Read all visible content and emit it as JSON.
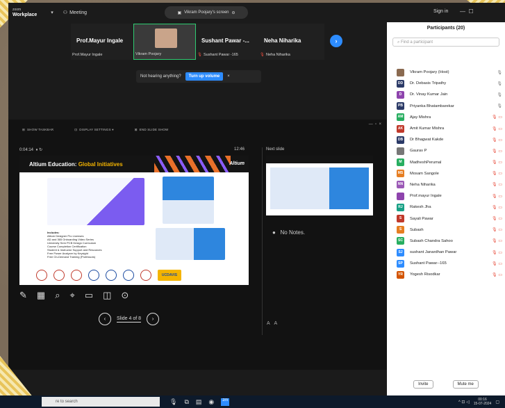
{
  "app": {
    "brand_top": "zoom",
    "brand": "Workplace",
    "meeting_label": "Meeting",
    "share_pill": "Vikram Poojary's screen",
    "signin": "Sign in"
  },
  "strip": [
    {
      "name": "Prof.Mayur Ingale",
      "sub": "Prof.Mayur Ingale",
      "muted": false,
      "active": false
    },
    {
      "name": "",
      "sub": "Vikram Poojary",
      "muted": false,
      "active": true
    },
    {
      "name": "Sushant Pawar -...",
      "sub": "Sushant Pawar -165",
      "muted": true,
      "active": false
    },
    {
      "name": "Neha Niharika",
      "sub": "Neha Niharika",
      "muted": true,
      "active": false
    }
  ],
  "notice": {
    "text": "Not hearing anything?",
    "button": "Turn up volume"
  },
  "presenter": {
    "toolbar": [
      "SHOW TASKBAR",
      "DISPLAY SETTINGS ▾",
      "END SLIDE SHOW"
    ],
    "timer": "0:04:14",
    "clock": "12:46",
    "next_slide_label": "Next slide",
    "notes": "No Notes.",
    "slide_nav": "Slide 4 of 8",
    "slide": {
      "title_part1": "Altium Education:",
      "title_part2": "Global Initiatives",
      "brand": "Altium",
      "includes": [
        "Includes:",
        "Altium Designer Pro Licenses",
        "AD and 365 Onboarding Video Series",
        "University Sem PCB Design Curriculum",
        "Course Completion Certification",
        "Student & Instructor Support and Resources",
        "Free Power Analyzer by Keysight",
        "Free On-Demand Training (Professors)"
      ],
      "ucdavis": "UCDAVIS"
    }
  },
  "participants": {
    "title": "Participants (20)",
    "search_placeholder": "Find a participant",
    "list": [
      {
        "initials": "",
        "name": "Vikram Poojary (Host)",
        "color": "#8a6a50",
        "muted": false
      },
      {
        "initials": "DD",
        "name": "Dr. Debasis Tripathy",
        "color": "#2b3a67",
        "muted": false
      },
      {
        "initials": "D",
        "name": "Dr. Vinay Kumar Jain",
        "color": "#8e44ad",
        "muted": false
      },
      {
        "initials": "PB",
        "name": "Priyanka Bhatambarekar",
        "color": "#2b3a67",
        "muted": false
      },
      {
        "initials": "AM",
        "name": "Ajay Mishra",
        "color": "#27ae60",
        "muted": true
      },
      {
        "initials": "AK",
        "name": "Amit Kumar Mishra",
        "color": "#c0392b",
        "muted": true
      },
      {
        "initials": "DB",
        "name": "Dr Bhagwat Kakde",
        "color": "#2b3a67",
        "muted": true
      },
      {
        "initials": "",
        "name": "Gaurav P",
        "color": "#777777",
        "muted": true
      },
      {
        "initials": "M",
        "name": "MadheshPerumal",
        "color": "#27ae60",
        "muted": true
      },
      {
        "initials": "MS",
        "name": "Mosam Sangole",
        "color": "#e67e22",
        "muted": true
      },
      {
        "initials": "NN",
        "name": "Neha Niharika",
        "color": "#9b59b6",
        "muted": true
      },
      {
        "initials": "",
        "name": "Prof.mayur Ingale",
        "color": "#8e44ad",
        "muted": true
      },
      {
        "initials": "RJ",
        "name": "Rakesh Jha",
        "color": "#16a085",
        "muted": true
      },
      {
        "initials": "S",
        "name": "Sayali Pawar",
        "color": "#c0392b",
        "muted": true
      },
      {
        "initials": "S",
        "name": "Subash",
        "color": "#e67e22",
        "muted": true
      },
      {
        "initials": "SC",
        "name": "Subash Chandra Sahoo",
        "color": "#27ae60",
        "muted": true
      },
      {
        "initials": "SJ",
        "name": "sushant Janardhan Pawar",
        "color": "#2d8cff",
        "muted": true
      },
      {
        "initials": "SP",
        "name": "Sushant Pawar--165",
        "color": "#2d8cff",
        "muted": true
      },
      {
        "initials": "YR",
        "name": "Yogesh Risodkar",
        "color": "#d35400",
        "muted": true
      }
    ],
    "invite": "Invite",
    "mute_all": "Mute me"
  },
  "taskbar": {
    "search": "re to search",
    "time": "00:16",
    "date": "15-07-2024"
  }
}
